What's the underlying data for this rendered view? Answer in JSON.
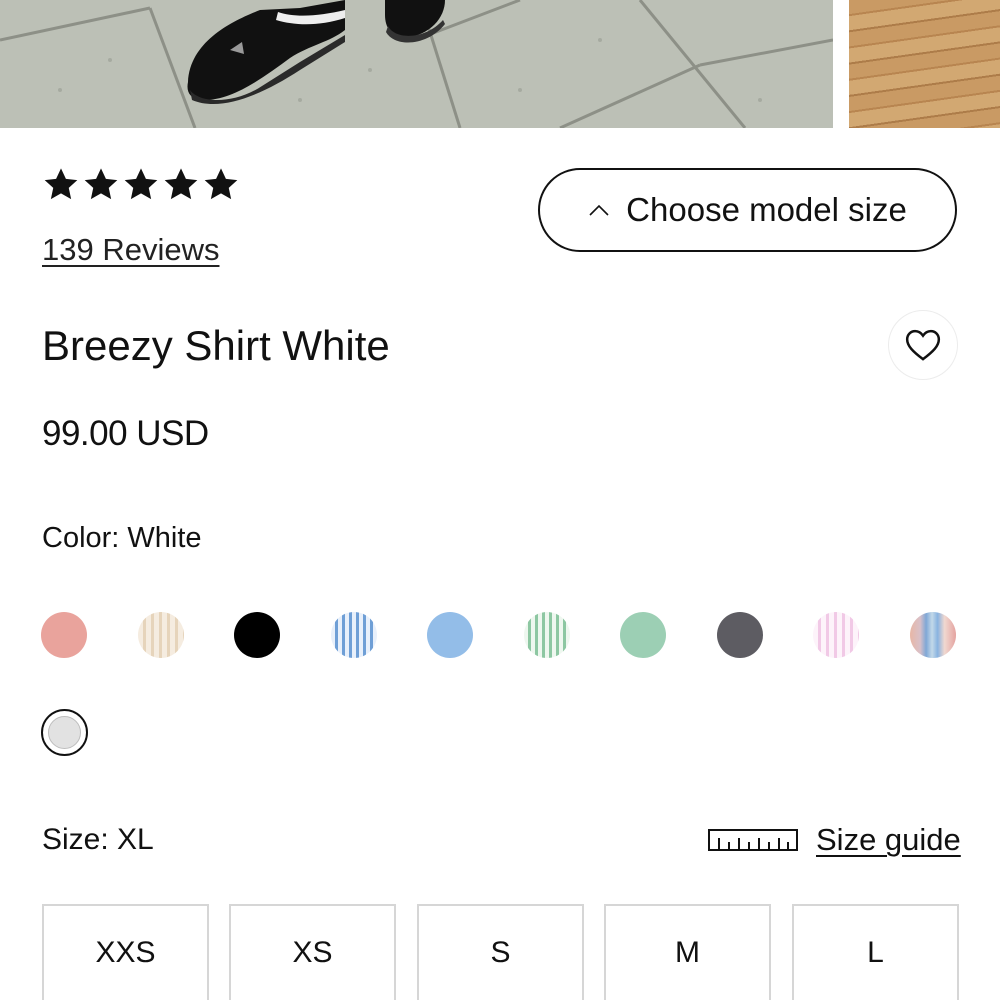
{
  "gallery": {
    "photos": [
      {
        "name": "product-photo-main"
      },
      {
        "name": "product-photo-next"
      }
    ]
  },
  "rating": {
    "stars": 5,
    "max_stars": 5,
    "reviews_text": "139 Reviews"
  },
  "model_size": {
    "label": "Choose model size",
    "icon": "chevron-up-icon"
  },
  "product": {
    "title": "Breezy Shirt White",
    "price": "99.00 USD",
    "wishlist_icon": "heart-icon"
  },
  "color": {
    "label": "Color: White",
    "selected": "White",
    "swatches": [
      {
        "name": "coral",
        "color": "#e9a39c"
      },
      {
        "name": "beige-stripe",
        "color": "#e6d4bb"
      },
      {
        "name": "black",
        "color": "#000000"
      },
      {
        "name": "blue-stripe",
        "color": "#6f9fd6"
      },
      {
        "name": "light-blue",
        "color": "#93bde8"
      },
      {
        "name": "green-stripe",
        "color": "#8dc7a2"
      },
      {
        "name": "mint-green",
        "color": "#9ccfb4"
      },
      {
        "name": "dark-grey",
        "color": "#5d5c62"
      },
      {
        "name": "pink-stripe",
        "color": "#f1c9e6"
      },
      {
        "name": "multicolor-stripe",
        "color": "#7fa7d6"
      },
      {
        "name": "white",
        "color": "#e2e2e2",
        "selected": true
      }
    ]
  },
  "size": {
    "label": "Size: XL",
    "selected": "XL",
    "guide_label": "Size guide",
    "guide_icon": "ruler-icon",
    "options": [
      "XXS",
      "XS",
      "S",
      "M",
      "L"
    ]
  },
  "colors": {
    "text": "#111111",
    "border": "#d6d6d6",
    "background": "#ffffff"
  }
}
